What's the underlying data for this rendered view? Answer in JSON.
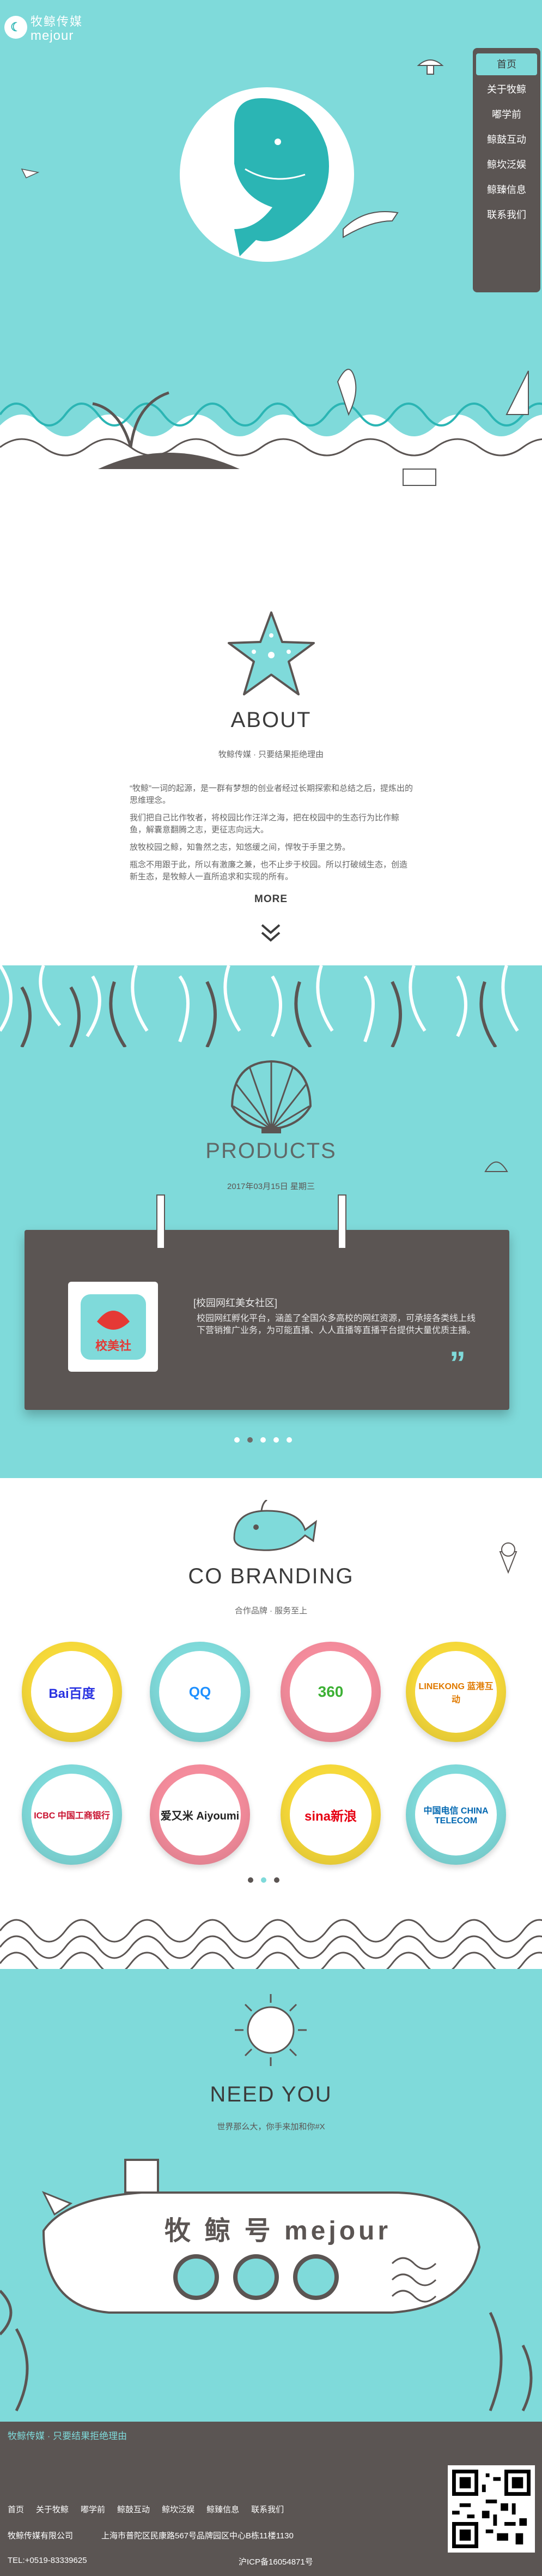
{
  "header": {
    "logo_cn": "牧鲸传媒",
    "logo_en": "mejour",
    "nav": [
      "首页",
      "关于牧鲸",
      "嘟学前",
      "鲸鼓互动",
      "鲸坎泛娱",
      "鲸臻信息",
      "联系我们"
    ]
  },
  "about": {
    "title": "ABOUT",
    "subtitle": "牧鲸传媒 · 只要结果拒绝理由",
    "paragraphs": [
      "“牧鲸”一词的起源，是一群有梦想的创业者经过长期探索和总结之后，提炼出的思维理念。",
      "我们把自己比作牧者，将校园比作汪洋之海，把在校园中的生态行为比作鲸鱼，解囊意翻腾之志，更征志向远大。",
      "放牧校园之鲸，知鲁然之志，知悠缓之间，悍牧于手里之势。",
      "瓶念不用跟于此，所以有激廉之兼，也不止步于校园。所以打破绒生态，创造新生态，是牧鲸人一直所追求和实现的所有。"
    ],
    "more": "MORE"
  },
  "products": {
    "title": "PRODUCTS",
    "date": "2017年03月15日 星期三",
    "card_title": "[校园网红美女社区]",
    "card_desc": "校园网红孵化平台，涵盖了全国众多高校的网红资源，可承接各类线上线下营销推广业务，为可能直播、人人直播等直播平台提供大量优质主播。",
    "logo_text": "校美社"
  },
  "branding": {
    "title": "CO BRANDING",
    "subtitle": "合作品牌 · 服务至上",
    "brands": [
      {
        "name": "Bai百度",
        "color": "#f6d93a"
      },
      {
        "name": "QQ",
        "color": "#7fdada"
      },
      {
        "name": "360",
        "color": "#f48c9c"
      },
      {
        "name": "LINEKONG 蓝港互动",
        "color": "#f6d93a"
      },
      {
        "name": "ICBC 中国工商银行",
        "color": "#7fdada"
      },
      {
        "name": "爱又米 Aiyoumi",
        "color": "#f48c9c"
      },
      {
        "name": "sina新浪",
        "color": "#f6d93a"
      },
      {
        "name": "中国电信 CHINA TELECOM",
        "color": "#7fdada"
      }
    ]
  },
  "need": {
    "title": "NEED YOU",
    "subtitle": "世界那么大，你手来加和你#X",
    "sub_text": "牧 鲸 号 mejour"
  },
  "footer": {
    "slogan": "牧鲸传媒 · 只要结果拒绝理由",
    "links": [
      "首页",
      "关于牧鲸",
      "嘟学前",
      "鲸鼓互动",
      "鲸坎泛娱",
      "鲸臻信息",
      "联系我们"
    ],
    "company": "牧鲸传媒有限公司",
    "address": "上海市普陀区民康路567号品牌园区中心B栋11楼1130",
    "phone": "TEL:+0519-83339625",
    "icp": "沪ICP备16054871号"
  },
  "colors": {
    "teal": "#7fdada",
    "dark": "#5b5553",
    "accent": "#2bb5b4"
  }
}
